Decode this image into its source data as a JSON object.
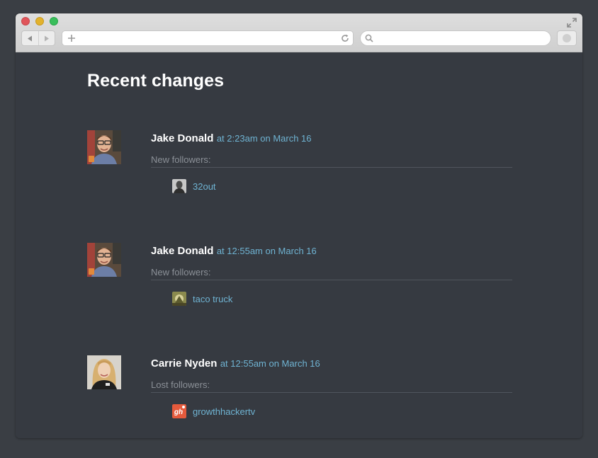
{
  "browser": {
    "address_value": "",
    "search_value": ""
  },
  "page": {
    "title": "Recent changes"
  },
  "entries": [
    {
      "user": "Jake Donald",
      "time": "at 2:23am on March 16",
      "label": "New followers:",
      "follower": "32out"
    },
    {
      "user": "Jake Donald",
      "time": "at 12:55am on March 16",
      "label": "New followers:",
      "follower": "taco truck"
    },
    {
      "user": "Carrie Nyden",
      "time": "at 12:55am on March 16",
      "label": "Lost followers:",
      "follower": "growthhackertv",
      "follower_badge": "gh"
    }
  ],
  "colors": {
    "background": "#363a41",
    "title": "#ffffff",
    "link": "#6fb3d2",
    "muted": "#8b9097",
    "divider": "#50555d",
    "badge": "#e55a3c"
  }
}
